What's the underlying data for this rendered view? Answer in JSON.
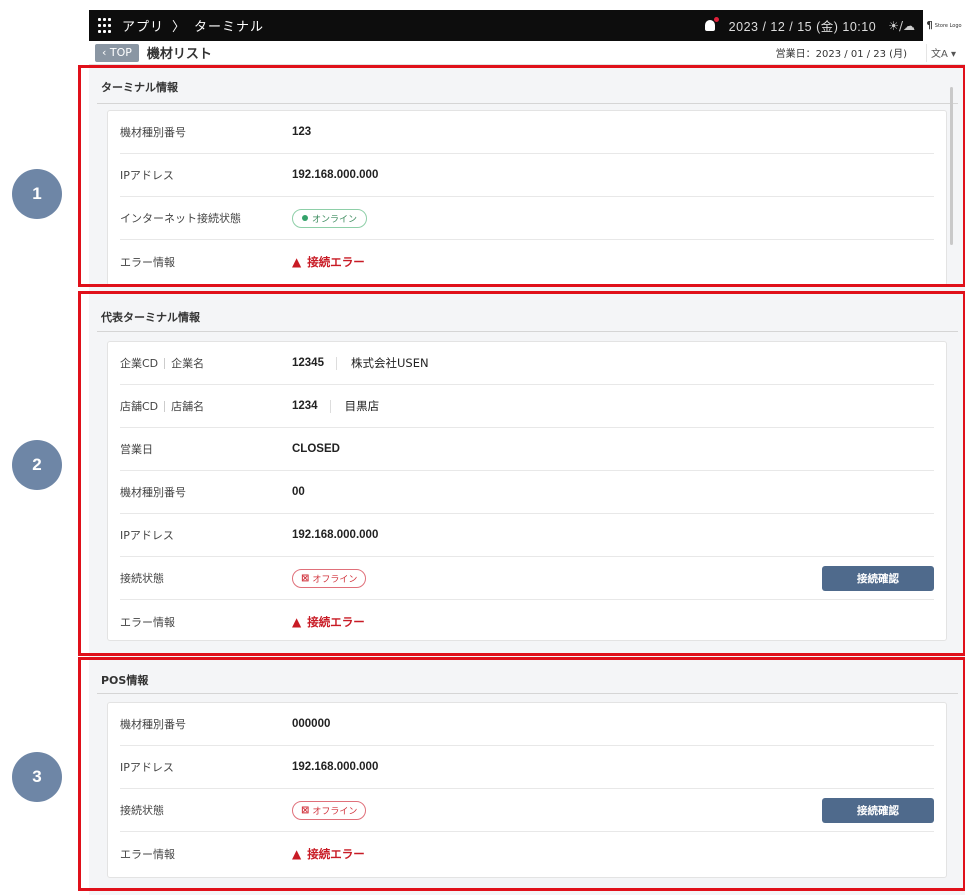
{
  "topbar": {
    "breadcrumb_root": "アプリ",
    "breadcrumb_separator": "〉",
    "breadcrumb_current": "ターミナル",
    "datetime": "2023 / 12 / 15  (金)  10:10",
    "weather": "☀/☁",
    "store_logo": "Store Logo"
  },
  "subbar": {
    "back_label": "‹ TOP",
    "page_title": "機材リスト",
    "business_date": "営業日：2023 / 01 / 23  (月)",
    "lang_label": "文A ▾"
  },
  "sections": {
    "terminal": {
      "title": "ターミナル情報",
      "rows": [
        {
          "label": "機材種別番号",
          "value": "123"
        },
        {
          "label": "IPアドレス",
          "value": "192.168.000.000"
        },
        {
          "label": "インターネット接続状態",
          "value": "オンライン"
        },
        {
          "label": "エラー情報",
          "value": "接続エラー"
        }
      ]
    },
    "representative": {
      "title": "代表ターミナル情報",
      "rows": [
        {
          "label_a": "企業CD",
          "label_b": "企業名",
          "value": "12345",
          "value2": "株式会社USEN"
        },
        {
          "label_a": "店舗CD",
          "label_b": "店舗名",
          "value": "1234",
          "value2": "目黒店"
        },
        {
          "label": "営業日",
          "value": "CLOSED"
        },
        {
          "label": "機材種別番号",
          "value": "00"
        },
        {
          "label": "IPアドレス",
          "value": "192.168.000.000"
        },
        {
          "label": "接続状態",
          "value": "オフライン",
          "button": "接続確認"
        },
        {
          "label": "エラー情報",
          "value": "接続エラー"
        }
      ]
    },
    "pos": {
      "title": "POS情報",
      "rows": [
        {
          "label": "機材種別番号",
          "value": "000000"
        },
        {
          "label": "IPアドレス",
          "value": "192.168.000.000"
        },
        {
          "label": "接続状態",
          "value": "オフライン",
          "button": "接続確認"
        },
        {
          "label": "エラー情報",
          "value": "接続エラー"
        }
      ]
    }
  },
  "annotations": [
    "1",
    "2",
    "3"
  ],
  "colors": {
    "annotation_red": "#e0101a",
    "annotation_circle": "#6e86a6",
    "button_blue": "#4f6a8c",
    "error_red": "#c81b25",
    "online_green": "#34a26a"
  }
}
